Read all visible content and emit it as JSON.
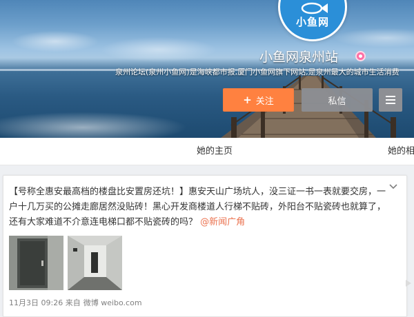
{
  "profile": {
    "logo_text": "小鱼网",
    "name": "小鱼网泉州站",
    "intro": "泉州论坛(泉州小鱼网)是海峡都市报,厦门小鱼网旗下网站,是泉州最大的城市生活消费",
    "follow_label": "关注",
    "follow_icon": "plus-icon",
    "message_label": "私信",
    "more_icon": "menu-icon"
  },
  "tabs": [
    {
      "label": "她的主页"
    },
    {
      "label": "她的相"
    }
  ],
  "post": {
    "text": "【号称全惠安最高档的楼盘比安置房还坑！】惠安天山广场坑人，没三证一书一表就要交房，一户十几万买的公摊走廊居然没贴砖！黑心开发商楼道人行梯不贴砖，外阳台不贴瓷砖也就算了，还有大家难道不介意连电梯口都不贴瓷砖的吗？",
    "mention": "@新闻广角",
    "images": [
      {
        "icon": "photo-door-image"
      },
      {
        "icon": "photo-corridor-image"
      }
    ],
    "time": "11月3日 09:26",
    "source_prefix": "来自",
    "source": "微博 weibo.com"
  },
  "colors": {
    "follow_bg": "#ff8140",
    "message_bg": "#8d8f94",
    "mention": "#eb7350",
    "logo_bg": "#2b8fd8"
  }
}
